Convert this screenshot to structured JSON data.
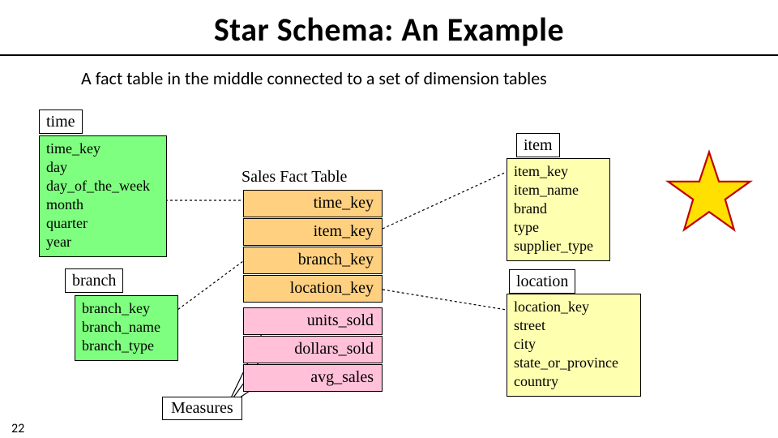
{
  "page": {
    "title": "Star Schema: An Example",
    "subtitle": "A fact table in the middle connected to a set of dimension tables",
    "page_number": "22"
  },
  "dimensions": {
    "time": {
      "label": "time",
      "fields": [
        "time_key",
        "day",
        "day_of_the_week",
        "month",
        "quarter",
        "year"
      ]
    },
    "item": {
      "label": "item",
      "fields": [
        "item_key",
        "item_name",
        "brand",
        "type",
        "supplier_type"
      ]
    },
    "branch": {
      "label": "branch",
      "fields": [
        "branch_key",
        "branch_name",
        "branch_type"
      ]
    },
    "location": {
      "label": "location",
      "fields": [
        "location_key",
        "street",
        "city",
        "state_or_province",
        "country"
      ]
    }
  },
  "fact_table": {
    "title": "Sales Fact Table",
    "keys": [
      "time_key",
      "item_key",
      "branch_key",
      "location_key"
    ],
    "measures": [
      "units_sold",
      "dollars_sold",
      "avg_sales"
    ]
  },
  "measures_label": "Measures"
}
